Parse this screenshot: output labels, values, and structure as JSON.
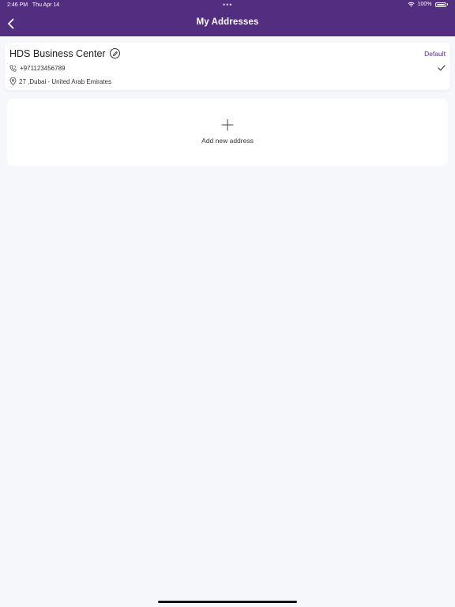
{
  "status_bar": {
    "time": "2:46 PM",
    "date": "Thu Apr 14",
    "dots": "•••",
    "battery": "100%"
  },
  "header": {
    "title": "My Addresses",
    "back_icon": "chevron-left-icon"
  },
  "address": {
    "name": "HDS Business Center",
    "default_label": "Default",
    "phone": "+971123456789",
    "location": "27 ,Dubai - United Arab Emirates",
    "selected": true
  },
  "add_address": {
    "label": "Add new address"
  },
  "colors": {
    "header_bg": "#522d80",
    "page_bg": "#f5f7fb",
    "accent": "#522d80"
  }
}
